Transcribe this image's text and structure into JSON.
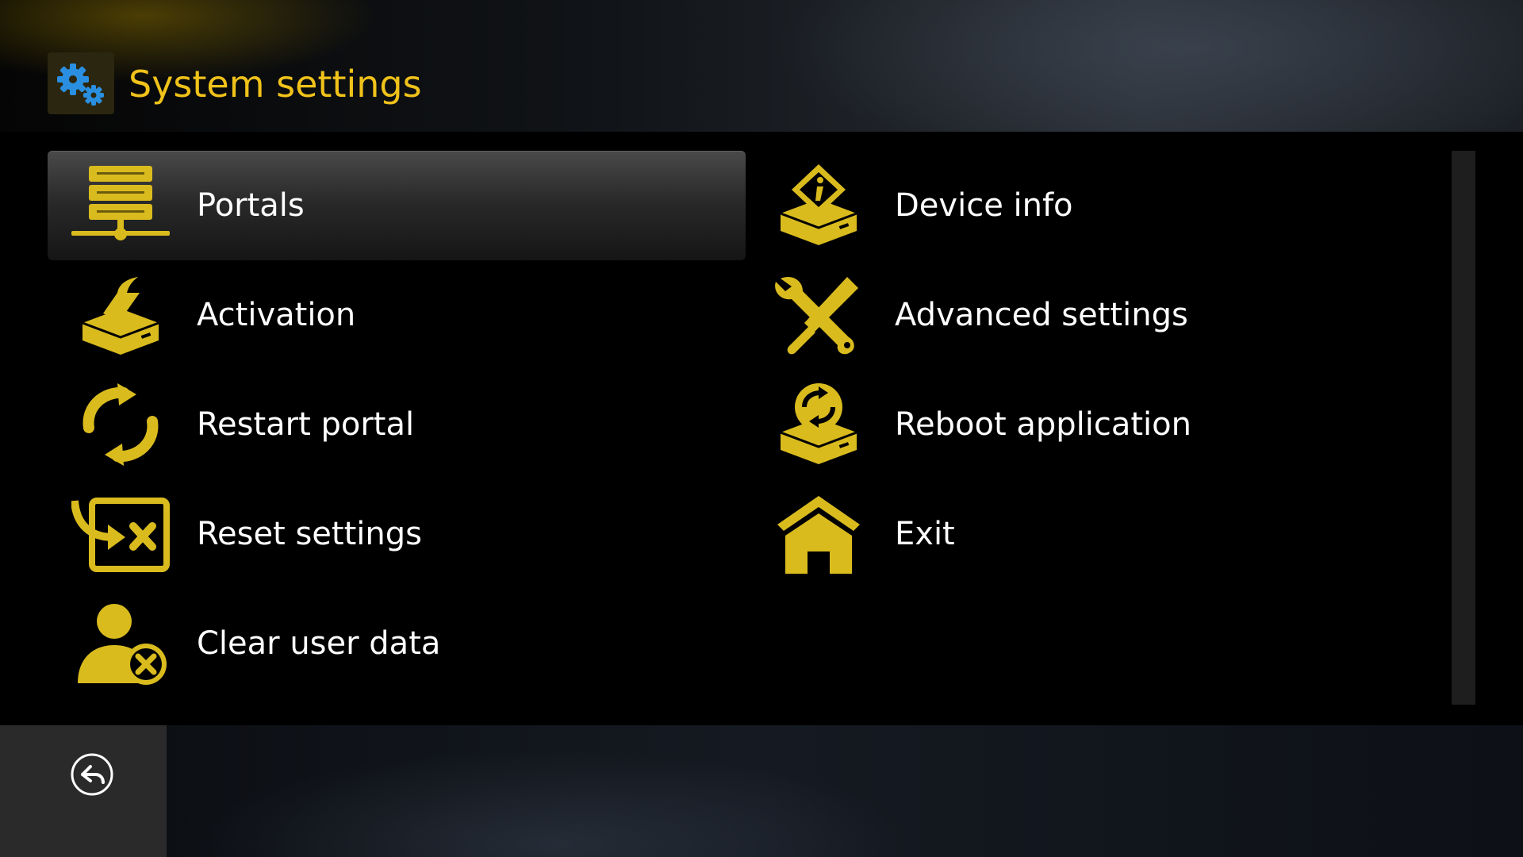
{
  "header": {
    "title": "System settings",
    "icon": "gears-icon"
  },
  "colors": {
    "accent": "#f0c21a",
    "icon_gold": "#d9bb1e",
    "text": "#ffffff",
    "selected_bg": "#3a3a3a"
  },
  "menu": {
    "left": [
      {
        "label": "Portals",
        "icon": "server-icon",
        "selected": true
      },
      {
        "label": "Activation",
        "icon": "activation-icon",
        "selected": false
      },
      {
        "label": "Restart portal",
        "icon": "restart-icon",
        "selected": false
      },
      {
        "label": "Reset settings",
        "icon": "reset-icon",
        "selected": false
      },
      {
        "label": "Clear user data",
        "icon": "clear-user-icon",
        "selected": false
      }
    ],
    "right": [
      {
        "label": "Device info",
        "icon": "device-info-icon",
        "selected": false
      },
      {
        "label": "Advanced settings",
        "icon": "tools-icon",
        "selected": false
      },
      {
        "label": "Reboot application",
        "icon": "reboot-icon",
        "selected": false
      },
      {
        "label": "Exit",
        "icon": "home-icon",
        "selected": false
      }
    ]
  },
  "footer": {
    "back_icon": "back-arrow-icon"
  }
}
